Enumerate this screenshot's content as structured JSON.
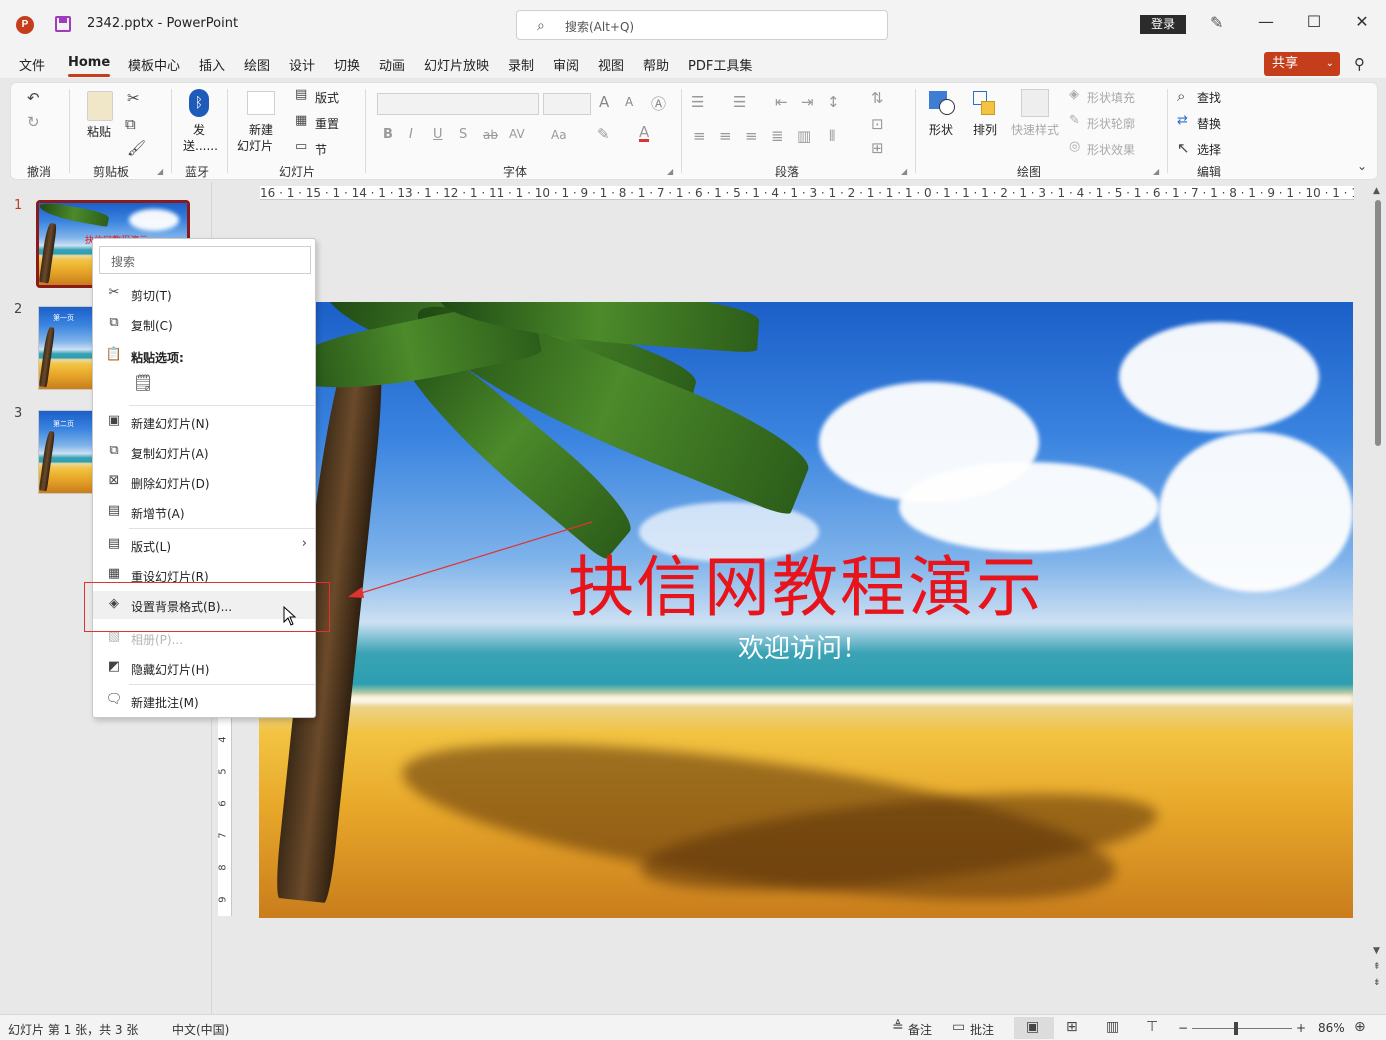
{
  "titlebar": {
    "logo": "P",
    "doc_title": "2342.pptx  -  PowerPoint",
    "search_placeholder": "搜索(Alt+Q)",
    "login": "登录",
    "minimize": "—",
    "maximize": "☐",
    "close": "✕"
  },
  "menu": {
    "tabs": [
      "文件",
      "Home",
      "模板中心",
      "插入",
      "绘图",
      "设计",
      "切换",
      "动画",
      "幻灯片放映",
      "录制",
      "审阅",
      "视图",
      "帮助",
      "PDF工具集"
    ],
    "share": "共享"
  },
  "ribbon": {
    "undo_group": "撤消",
    "clipboard": {
      "label": "剪贴板",
      "paste": "粘贴"
    },
    "bluetooth": {
      "label": "蓝牙",
      "send_line1": "发",
      "send_line2": "送......"
    },
    "slides": {
      "label": "幻灯片",
      "new_line1": "新建",
      "new_line2": "幻灯片",
      "layout": "版式",
      "reset": "重置",
      "section": "节"
    },
    "font": {
      "label": "字体",
      "bold": "B",
      "italic": "I",
      "underline": "U",
      "shadow": "S",
      "strike": "ab",
      "spacing": "AV",
      "case": "Aa",
      "grow": "A",
      "shrink": "A"
    },
    "paragraph": {
      "label": "段落"
    },
    "drawing": {
      "label": "绘图",
      "shapes": "形状",
      "arrange": "排列",
      "quick_styles": "快速样式",
      "fill": "形状填充",
      "outline": "形状轮廓",
      "effects": "形状效果"
    },
    "editing": {
      "label": "编辑",
      "find": "查找",
      "replace": "替换",
      "select": "选择"
    }
  },
  "slides_pane": {
    "numbers": [
      "1",
      "2",
      "3"
    ],
    "thumb_titles": [
      "抉信网教程演示",
      "第一页",
      "第二页"
    ]
  },
  "ruler": {
    "h": "16 · 1 · 15 · 1 · 14 · 1 · 13 · 1 · 12 · 1 · 11 · 1 · 10 · 1 · 9 · 1 · 8 · 1 · 7 · 1 · 6 · 1 · 5 · 1 · 4 · 1 · 3 · 1 · 2 · 1 · 1 · 1 · 0 · 1 · 1 · 1 · 2 · 1 · 3 · 1 · 4 · 1 · 5 · 1 · 6 · 1 · 7 · 1 · 8 · 1 · 9 · 1 · 10 · 1 · 11 · 1 · 12 · 1 · 13 · 1 · 14 · 1 · 15 · 1 · 16",
    "v": [
      "4",
      "5",
      "6",
      "7",
      "8",
      "9"
    ]
  },
  "slide": {
    "title": "抉信网教程演示",
    "subtitle": "欢迎访问！"
  },
  "context_menu": {
    "search": "搜索",
    "cut": "剪切(T)",
    "copy": "复制(C)",
    "paste_options": "粘贴选项:",
    "new_slide": "新建幻灯片(N)",
    "duplicate_slide": "复制幻灯片(A)",
    "delete_slide": "删除幻灯片(D)",
    "add_section": "新增节(A)",
    "layout": "版式(L)",
    "reset_slide": "重设幻灯片(R)",
    "format_background": "设置背景格式(B)...",
    "photo_album": "相册(P)...",
    "hide_slide": "隐藏幻灯片(H)",
    "new_comment": "新建批注(M)"
  },
  "statusbar": {
    "slide_info": "幻灯片 第 1 张，共 3 张",
    "language": "中文(中国)",
    "notes": "备注",
    "comments": "批注",
    "zoom": "86%"
  },
  "colors": {
    "accent": "#c43e1c",
    "title_red": "#e8141b",
    "highlight": "#e0322f"
  }
}
